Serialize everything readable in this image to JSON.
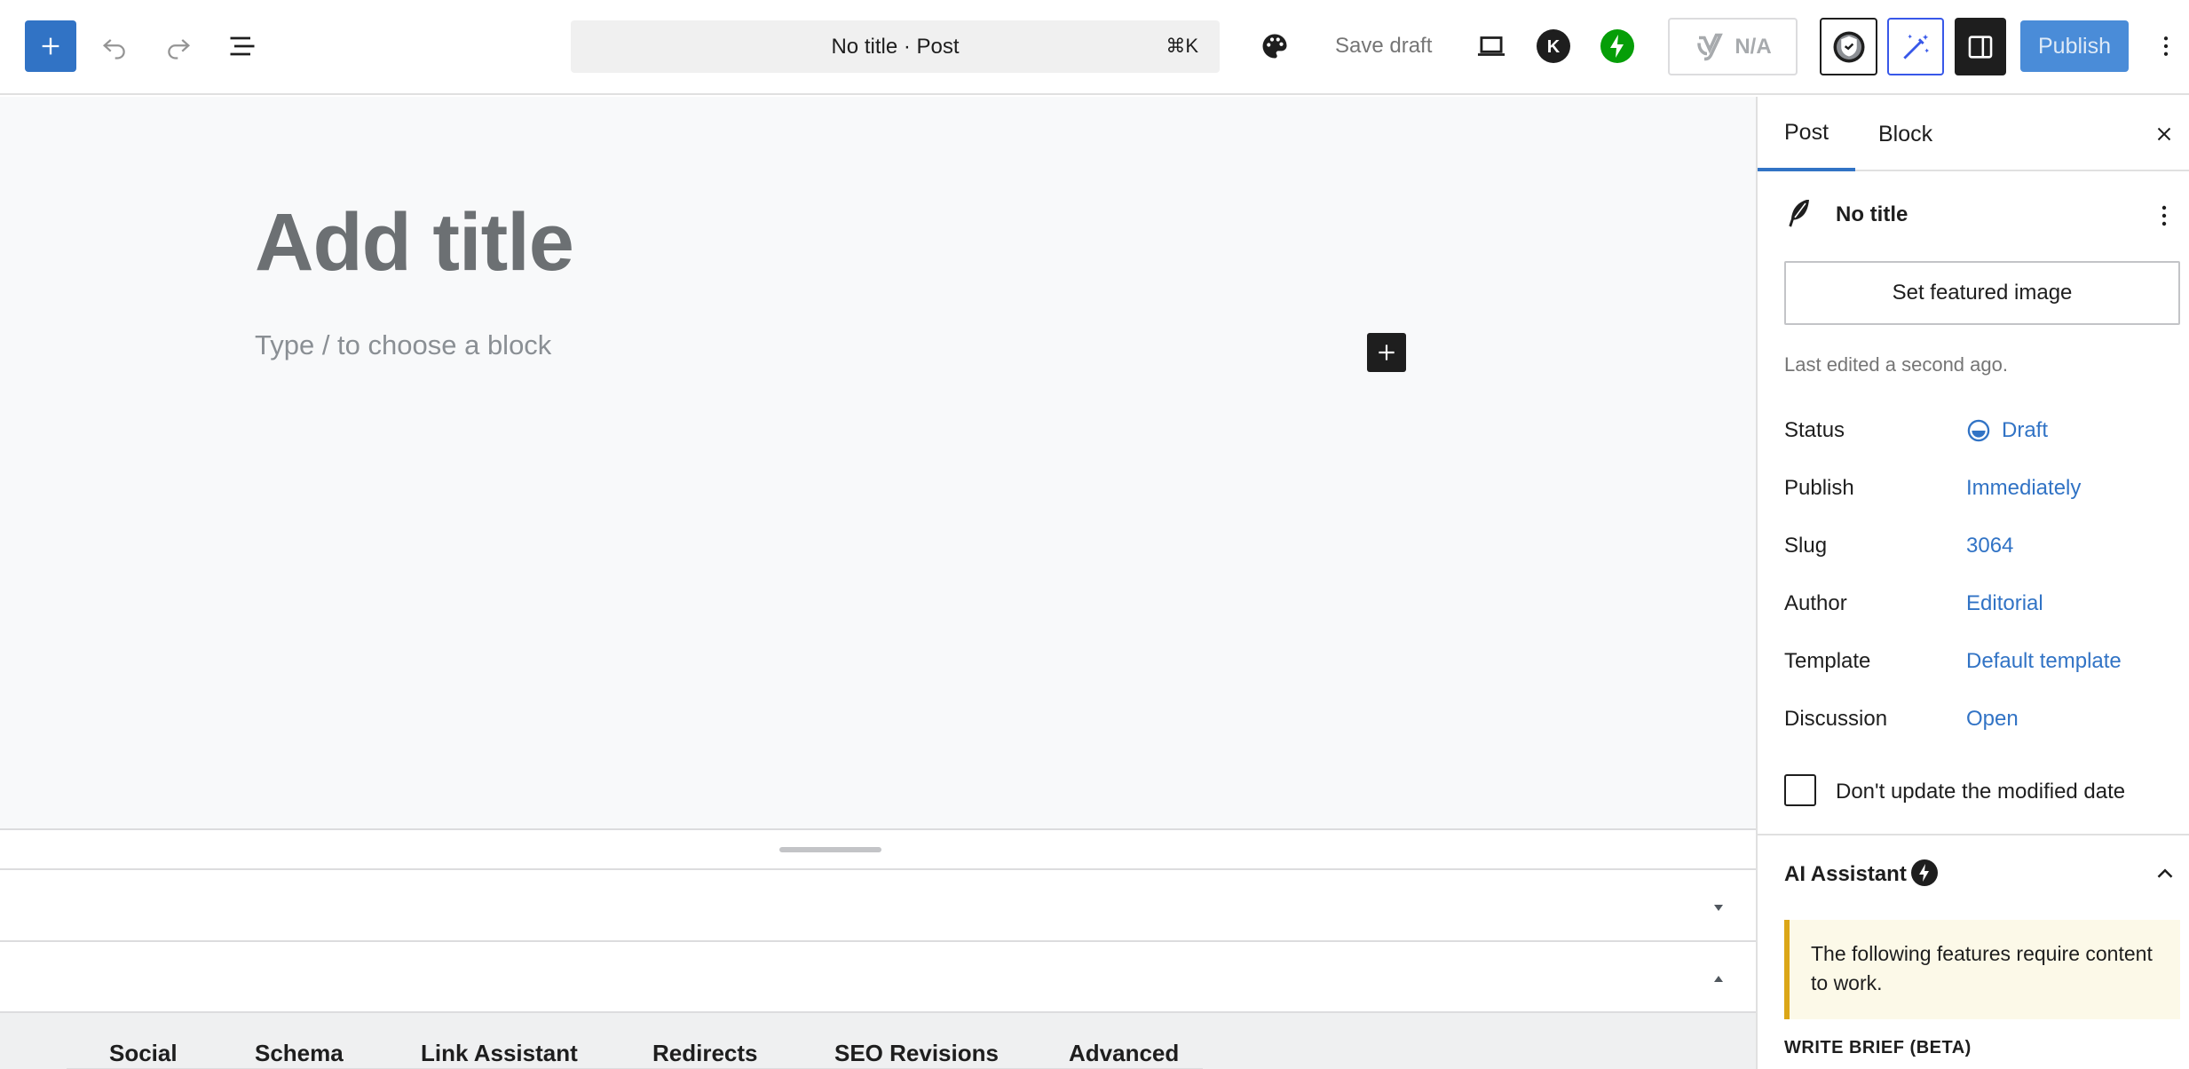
{
  "toolbar": {
    "command_title": "No title · Post",
    "command_shortcut": "⌘K",
    "save_draft_label": "Save draft",
    "seo_score_label": "N/A",
    "publish_label": "Publish",
    "icons": {
      "inserter": "plus-icon",
      "undo": "undo-icon",
      "redo": "redo-icon",
      "list_view": "list-view-icon",
      "styles": "palette-icon",
      "preview": "laptop-icon",
      "k_plugin": "k-avatar-icon",
      "jetpack": "bolt-icon",
      "seo": "yoast-icon",
      "security": "shield-icon",
      "ai": "magic-wand-icon",
      "settings": "sidebar-toggle-icon",
      "options": "more-vertical-icon"
    },
    "colors": {
      "primary": "#3173c5",
      "publish_bg": "#4a8cd8",
      "ai_accent": "#3858e9",
      "jetpack_green": "#069e08"
    }
  },
  "editor": {
    "title_placeholder": "Add title",
    "block_placeholder": "Type / to choose a block"
  },
  "seo_panel": {
    "tabs": [
      "Social",
      "Schema",
      "Link Assistant",
      "Redirects",
      "SEO Revisions",
      "Advanced"
    ]
  },
  "sidebar": {
    "tabs": {
      "post": "Post",
      "block": "Block"
    },
    "document_title": "No title",
    "featured_image_label": "Set featured image",
    "last_edited": "Last edited a second ago.",
    "meta": [
      {
        "label": "Status",
        "value": "Draft"
      },
      {
        "label": "Publish",
        "value": "Immediately"
      },
      {
        "label": "Slug",
        "value": "3064"
      },
      {
        "label": "Author",
        "value": "Editorial"
      },
      {
        "label": "Template",
        "value": "Default template"
      },
      {
        "label": "Discussion",
        "value": "Open"
      }
    ],
    "modified_date_label": "Don't update the modified date",
    "modified_date_checked": false,
    "ai_assistant": {
      "title": "AI Assistant",
      "notice": "The following features require content to work.",
      "section_label": "WRITE BRIEF (BETA)"
    }
  }
}
